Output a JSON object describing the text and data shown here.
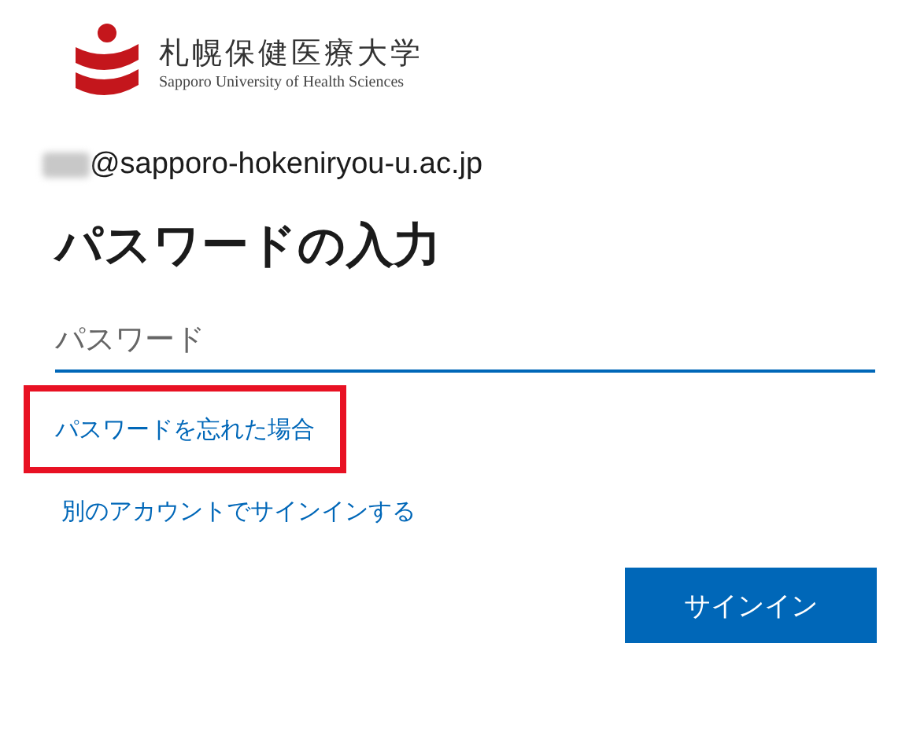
{
  "logo": {
    "name": "札幌保健医療大学",
    "subtitle": "Sapporo University of Health Sciences"
  },
  "account": {
    "email": "@sapporo-hokeniryou-u.ac.jp",
    "redacted": true
  },
  "heading": "パスワードの入力",
  "password_field": {
    "placeholder": "パスワード"
  },
  "links": [
    {
      "label": "パスワードを忘れた場合",
      "highlighted": true
    },
    {
      "label": "別のアカウントでサインインする",
      "highlighted": false
    }
  ],
  "button": "サインイン"
}
